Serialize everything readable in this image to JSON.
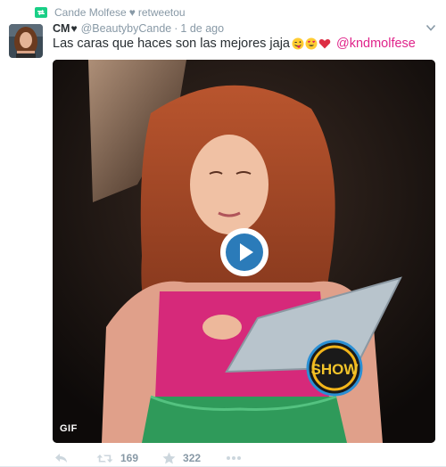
{
  "retweet_context": {
    "name": "Cande Molfese",
    "heart": "♥",
    "action": "retweetou"
  },
  "tweet": {
    "fullname": "CM",
    "name_heart": "♥",
    "handle": "@BeautybyCande",
    "separator": "·",
    "timestamp": "1 de ago",
    "text": "Las caras que haces son las mejores jaja",
    "emojis": [
      "winking-tongue-emoji",
      "heart-eyes-emoji",
      "red-heart-emoji"
    ],
    "mention": "@kndmolfese"
  },
  "media": {
    "badge": "GIF",
    "overlay_logo_text": "SHOW"
  },
  "actions": {
    "retweets": "169",
    "likes": "322"
  },
  "colors": {
    "accent": "#2b7bb9",
    "mention": "#e0248b",
    "muted": "#8899a6",
    "retweet_green": "#19cf86"
  }
}
